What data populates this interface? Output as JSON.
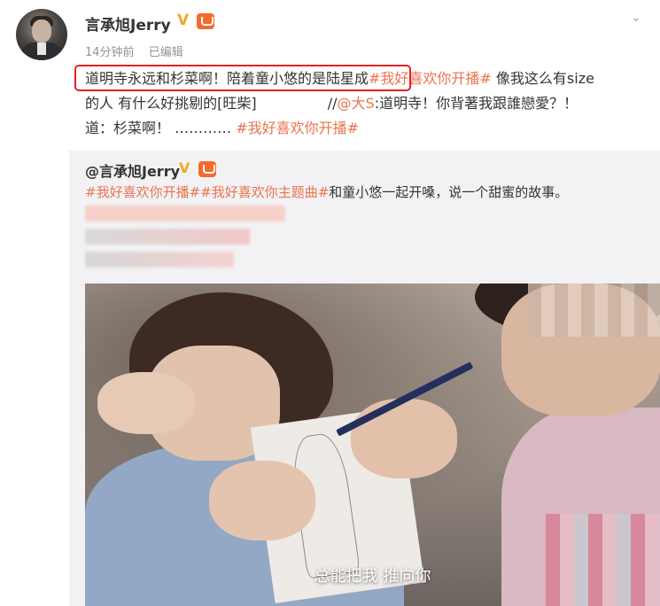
{
  "post": {
    "username": "言承旭Jerry",
    "time": "14分钟前",
    "edited": "已编辑",
    "line1_highlight": "道明寺永远和杉菜啊！陪着童小悠的是陆星成",
    "topic1": "#我好喜欢你开播#",
    "line1_tail": " 像我这么有size",
    "line2_text": "的人 有什么好挑剔的[旺柴]",
    "line2_mention_prefix": "//",
    "mention": "@大S",
    "line2_tail": ":道明寺！你背著我跟誰戀愛？！",
    "line3_text": "道：杉菜啊！ …………",
    "topic2": "#我好喜欢你开播#"
  },
  "repost": {
    "username": "@言承旭Jerry",
    "topic1": "#我好喜欢你开播#",
    "topic2": "#我好喜欢你主题曲#",
    "text": "和童小悠一起开嗓，说一个甜蜜的故事。"
  },
  "video": {
    "subtitle": "总能把我  推向你"
  },
  "icons": {
    "verified": "verified-v-icon",
    "member": "member-badge-icon",
    "more": "chevron-down-icon"
  },
  "colors": {
    "topic": "#eb7350",
    "highlight_box": "#e02020",
    "verified": "#f5a623"
  }
}
